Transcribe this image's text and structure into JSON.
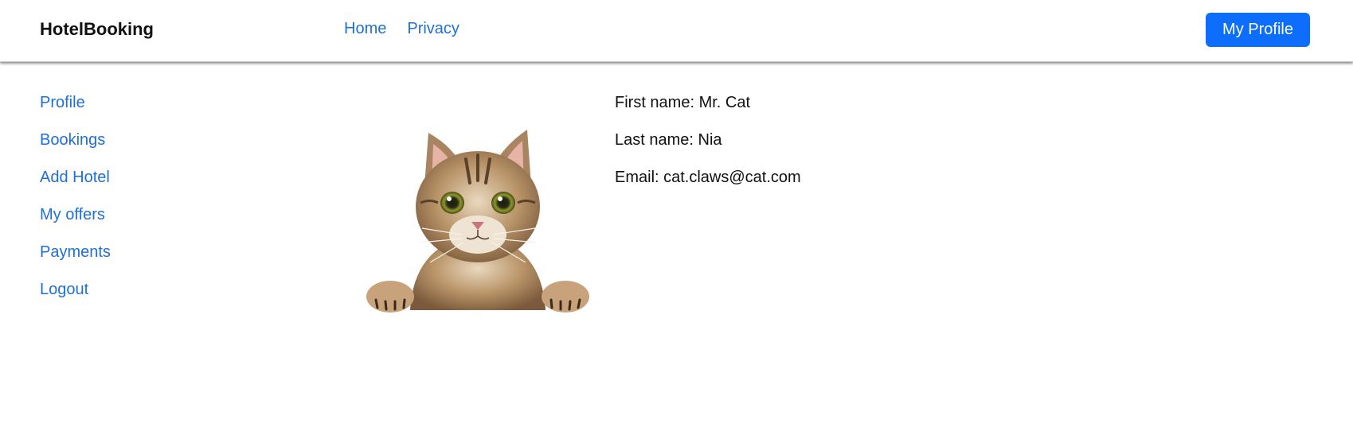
{
  "navbar": {
    "brand": "HotelBooking",
    "links": [
      "Home",
      "Privacy"
    ],
    "profile_button": "My Profile",
    "accent": "#0d6efd",
    "link_color": "#1f6fd8"
  },
  "sidebar": {
    "items": [
      "Profile",
      "Bookings",
      "Add Hotel",
      "My offers",
      "Payments",
      "Logout"
    ]
  },
  "profile": {
    "avatar_icon": "cat-photo-icon",
    "first_name": "First name: Mr. Cat",
    "last_name": "Last name: Nia",
    "email": "Email: cat.claws@cat.com"
  }
}
